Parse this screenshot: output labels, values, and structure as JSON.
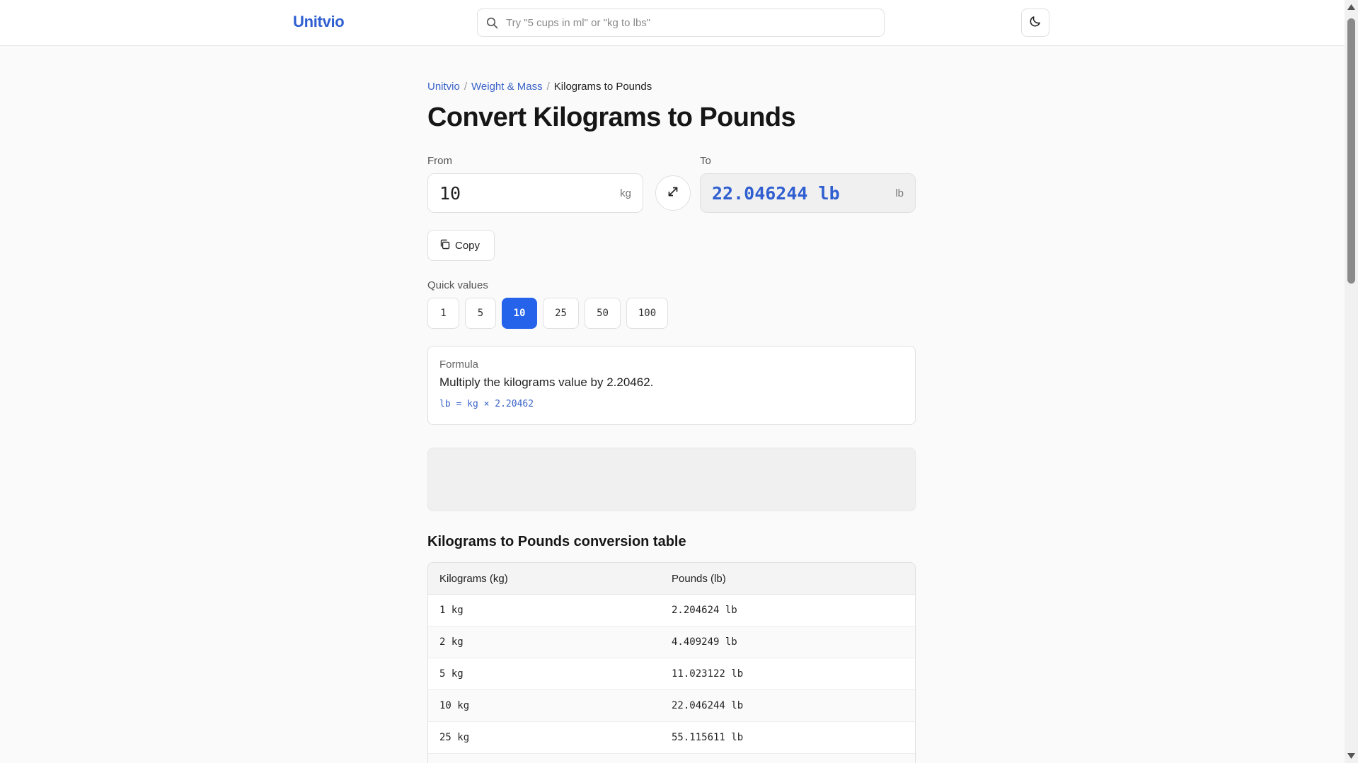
{
  "header": {
    "logo": "Unitvio",
    "search_placeholder": "Try \"5 cups in ml\" or \"kg to lbs\"",
    "theme_icon": "moon-icon"
  },
  "breadcrumb": {
    "items": [
      "Unitvio",
      "Weight & Mass"
    ],
    "current": "Kilograms to Pounds",
    "separator": "/"
  },
  "page_title": "Convert Kilograms to Pounds",
  "converter": {
    "from_label": "From",
    "from_value": "10",
    "from_unit": "kg",
    "to_label": "To",
    "to_value": "22.046244 lb",
    "to_unit": "lb",
    "swap_icon": "swap-icon",
    "copy_label": "Copy"
  },
  "quick_values": {
    "label": "Quick values",
    "items": [
      "1",
      "5",
      "10",
      "25",
      "50",
      "100"
    ],
    "active": "10"
  },
  "formula": {
    "title": "Formula",
    "description": "Multiply the kilograms value by 2.20462.",
    "code": "lb = kg × 2.20462"
  },
  "table": {
    "heading": "Kilograms to Pounds conversion table",
    "columns": [
      "Kilograms (kg)",
      "Pounds (lb)"
    ],
    "rows": [
      [
        "1 kg",
        "2.204624 lb"
      ],
      [
        "2 kg",
        "4.409249 lb"
      ],
      [
        "5 kg",
        "11.023122 lb"
      ],
      [
        "10 kg",
        "22.046244 lb"
      ],
      [
        "25 kg",
        "55.115611 lb"
      ]
    ]
  },
  "colors": {
    "accent": "#2563eb",
    "brand": "#2f5fd0",
    "link": "#3a63c9"
  }
}
